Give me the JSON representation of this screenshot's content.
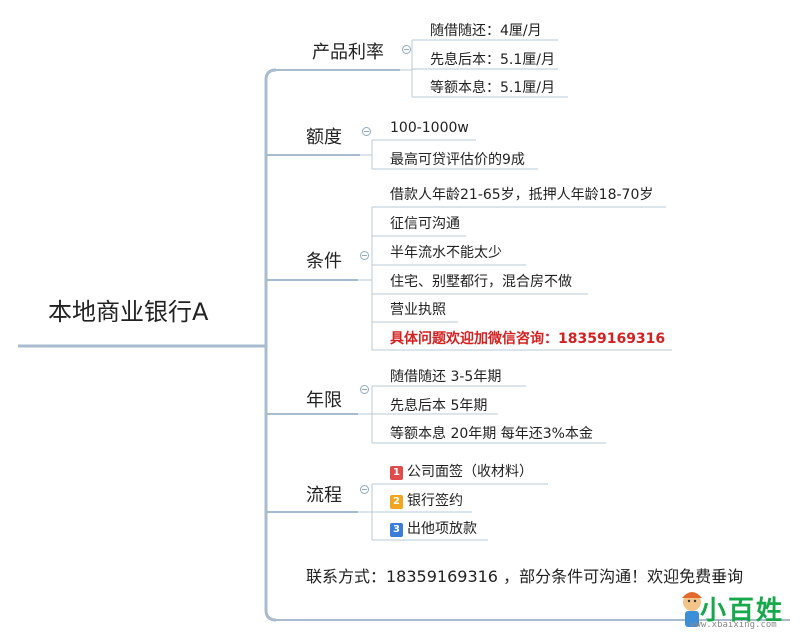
{
  "root": "本地商业银行A",
  "branches": [
    {
      "label": "产品利率",
      "items": [
        "随借随还：4厘/月",
        "先息后本：5.1厘/月",
        "等额本息：5.1厘/月"
      ]
    },
    {
      "label": "额度",
      "items": [
        "100-1000w",
        "最高可贷评估价的9成"
      ]
    },
    {
      "label": "条件",
      "items": [
        "借款人年龄21-65岁，抵押人年龄18-70岁",
        "征信可沟通",
        "半年流水不能太少",
        "住宅、别墅都行，混合房不做",
        "营业执照",
        "具体问题欢迎加微信咨询：18359169316"
      ]
    },
    {
      "label": "年限",
      "items": [
        "随借随还 3-5年期",
        "先息后本 5年期",
        "等额本息 20年期 每年还3%本金"
      ]
    },
    {
      "label": "流程",
      "items": [
        {
          "badge": "1",
          "text": "公司面签（收材料）"
        },
        {
          "badge": "2",
          "text": "银行签约"
        },
        {
          "badge": "3",
          "text": "出他项放款"
        }
      ]
    }
  ],
  "contact": "联系方式：18359169316 ，部分条件可沟通！欢迎免费垂询",
  "watermark": {
    "text": "小百姓",
    "url": "www.xbaixing.com"
  },
  "colors": {
    "line": "#a9bccf",
    "accent_red": "#d42222"
  }
}
